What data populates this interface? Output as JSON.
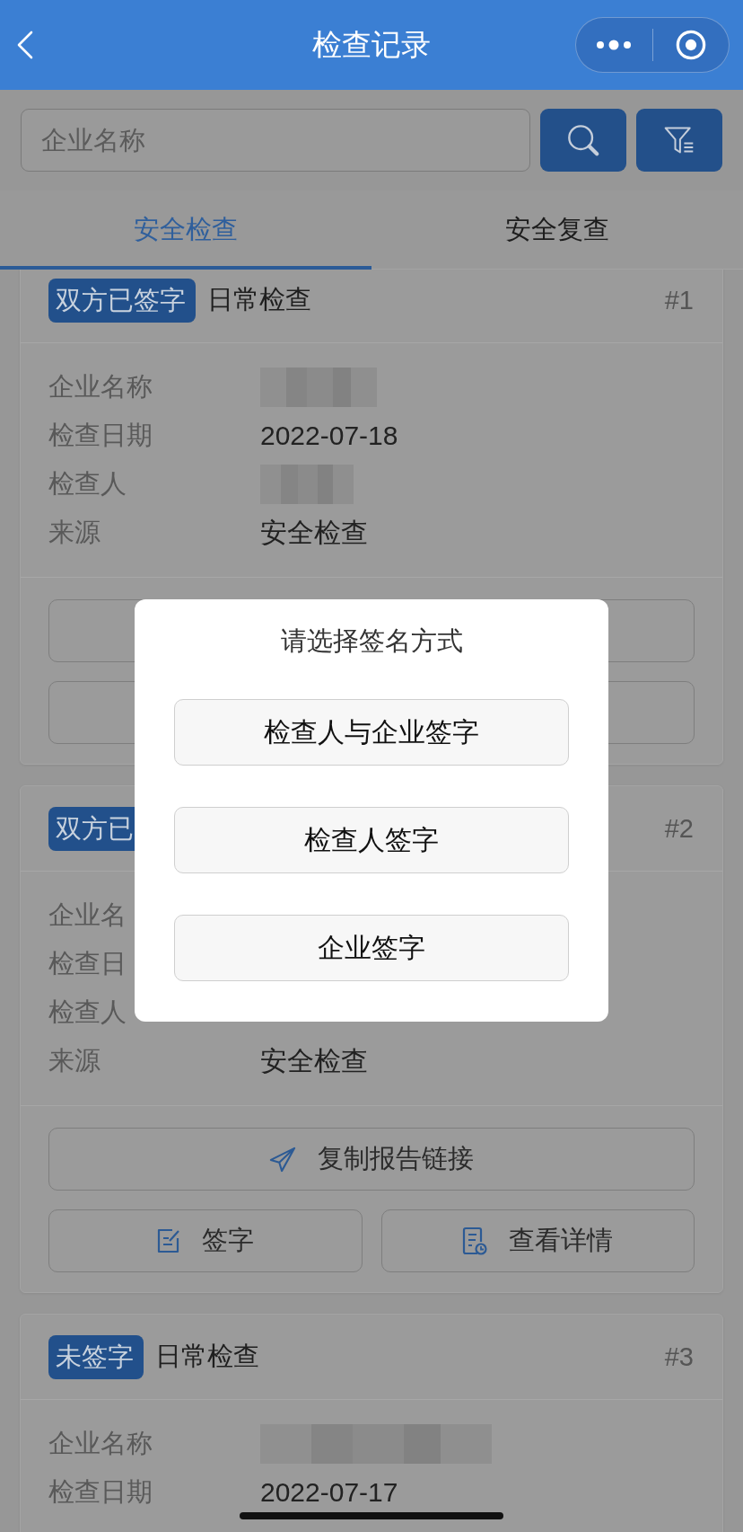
{
  "nav": {
    "title": "检查记录"
  },
  "search": {
    "placeholder": "企业名称"
  },
  "tabs": [
    {
      "label": "安全检查",
      "selected": true
    },
    {
      "label": "安全复查",
      "selected": false
    }
  ],
  "records": [
    {
      "badge": "双方已签字",
      "title": "日常检查",
      "number": "#1",
      "fields": [
        {
          "label": "企业名称",
          "redacted": true
        },
        {
          "label": "检查日期",
          "value": "2022-07-18"
        },
        {
          "label": "检查人",
          "redacted": true
        },
        {
          "label": "来源",
          "value": "安全检查"
        }
      ],
      "actions": [
        {
          "kind": "copy-link"
        },
        {
          "kind": "sign"
        },
        {
          "kind": "details"
        }
      ]
    },
    {
      "badge": "双方已",
      "number": "#2",
      "fields": [
        {
          "label": "企业名"
        },
        {
          "label": "检查日"
        },
        {
          "label": "检查人"
        },
        {
          "label": "来源",
          "value": "安全检查"
        }
      ],
      "actions": [
        {
          "kind": "copy-link",
          "label": "复制报告链接"
        },
        {
          "kind": "sign",
          "label": "签字"
        },
        {
          "kind": "details",
          "label": "查看详情"
        }
      ]
    },
    {
      "badge": "未签字",
      "title": "日常检查",
      "number": "#3",
      "fields": [
        {
          "label": "企业名称",
          "redacted": true
        },
        {
          "label": "检查日期",
          "value": "2022-07-17"
        }
      ]
    }
  ],
  "dialog": {
    "title": "请选择签名方式",
    "options": [
      "检查人与企业签字",
      "检查人签字",
      "企业签字"
    ]
  }
}
